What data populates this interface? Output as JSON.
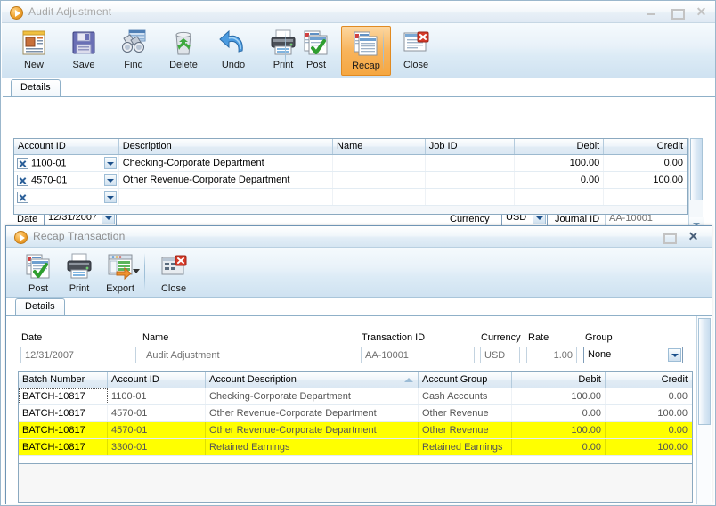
{
  "outer_window": {
    "title": "Audit Adjustment",
    "icon": "play-circle-icon",
    "controls": {
      "minimize": "minimize-icon",
      "maximize": "maximize-icon",
      "close": "close-icon"
    },
    "toolbar": [
      {
        "label": "New",
        "icon": "new-document-icon",
        "selected": false
      },
      {
        "label": "Save",
        "icon": "floppy-disk-icon",
        "selected": false
      },
      {
        "label": "Find",
        "icon": "binoculars-icon",
        "selected": false
      },
      {
        "label": "Delete",
        "icon": "recycle-bin-icon",
        "selected": false
      },
      {
        "label": "Undo",
        "icon": "undo-arrow-icon",
        "selected": false
      },
      {
        "label": "Print",
        "icon": "printer-icon",
        "selected": false
      },
      {
        "label": "Post",
        "icon": "post-check-icon",
        "selected": false
      },
      {
        "label": "Recap",
        "icon": "recap-icon",
        "selected": true
      },
      {
        "label": "Close",
        "icon": "close-window-icon",
        "selected": false
      }
    ],
    "tab": "Details",
    "fields": {
      "date_label": "Date",
      "date_value": "12/31/2007",
      "currency_label": "Currency",
      "currency_value": "USD",
      "journal_label": "Journal ID",
      "journal_value": "AA-10001"
    },
    "grid": {
      "columns": [
        "Account ID",
        "Description",
        "Name",
        "Job ID",
        "Debit",
        "Credit"
      ],
      "rows": [
        {
          "account_id": "1100-01",
          "description": "Checking-Corporate Department",
          "name": "",
          "job_id": "",
          "debit": "100.00",
          "credit": "0.00"
        },
        {
          "account_id": "4570-01",
          "description": "Other Revenue-Corporate Department",
          "name": "",
          "job_id": "",
          "debit": "0.00",
          "credit": "100.00"
        },
        {
          "account_id": "",
          "description": "",
          "name": "",
          "job_id": "",
          "debit": "",
          "credit": ""
        }
      ]
    }
  },
  "inner_window": {
    "title": "Recap Transaction",
    "icon": "play-circle-icon",
    "controls": {
      "maximize": "maximize-icon",
      "close": "close-icon"
    },
    "toolbar": [
      {
        "label": "Post",
        "icon": "post-check-icon",
        "has_dropdown": false
      },
      {
        "label": "Print",
        "icon": "printer-icon",
        "has_dropdown": false
      },
      {
        "label": "Export",
        "icon": "export-icon",
        "has_dropdown": true
      },
      {
        "label": "Close",
        "icon": "close-window-icon",
        "has_dropdown": false
      }
    ],
    "tab": "Details",
    "fields": {
      "date_label": "Date",
      "date_value": "12/31/2007",
      "name_label": "Name",
      "name_value": "Audit Adjustment",
      "transaction_label": "Transaction ID",
      "transaction_value": "AA-10001",
      "currency_label": "Currency",
      "currency_value": "USD",
      "rate_label": "Rate",
      "rate_value": "1.00",
      "group_label": "Group",
      "group_value": "None"
    },
    "grid": {
      "columns": [
        "Batch Number",
        "Account ID",
        "Account Description",
        "Account Group",
        "Debit",
        "Credit"
      ],
      "sorted_column": "Account Description",
      "rows": [
        {
          "batch": "BATCH-10817",
          "account_id": "1100-01",
          "description": "Checking-Corporate Department",
          "group": "Cash Accounts",
          "debit": "100.00",
          "credit": "0.00",
          "highlighted": false
        },
        {
          "batch": "BATCH-10817",
          "account_id": "4570-01",
          "description": "Other Revenue-Corporate Department",
          "group": "Other Revenue",
          "debit": "0.00",
          "credit": "100.00",
          "highlighted": false
        },
        {
          "batch": "BATCH-10817",
          "account_id": "4570-01",
          "description": "Other Revenue-Corporate Department",
          "group": "Other Revenue",
          "debit": "100.00",
          "credit": "0.00",
          "highlighted": true
        },
        {
          "batch": "BATCH-10817",
          "account_id": "3300-01",
          "description": "Retained Earnings",
          "group": "Retained Earnings",
          "debit": "0.00",
          "credit": "100.00",
          "highlighted": true
        }
      ]
    }
  },
  "colors": {
    "highlight_row": "#ffff00",
    "selected_toolbar": "#f5a742",
    "title_text": "#a8a8a8",
    "grid_border": "#8ba9c0"
  }
}
